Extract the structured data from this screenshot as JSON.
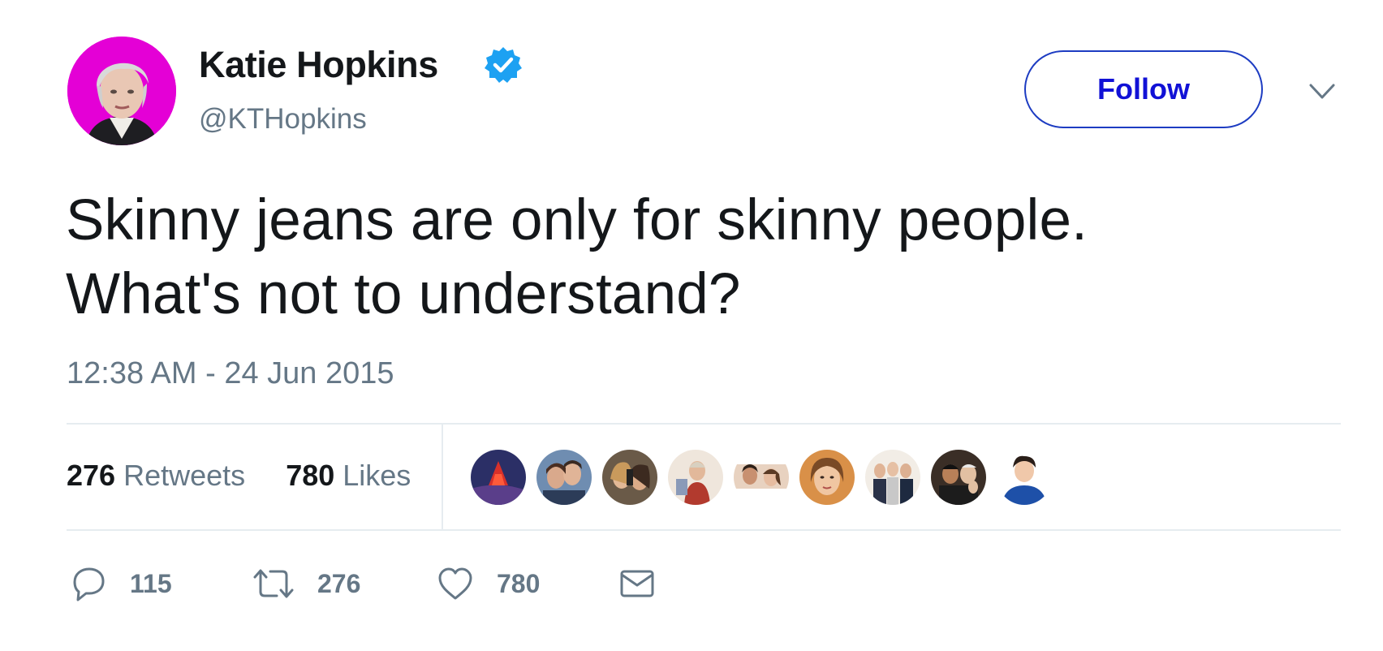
{
  "user": {
    "display_name": "Katie Hopkins",
    "handle": "@KTHopkins",
    "verified": true,
    "avatar_icon": "user-avatar"
  },
  "follow_button_label": "Follow",
  "menu_icon": "chevron-down-icon",
  "tweet": {
    "lines": [
      "Skinny jeans are only for skinny people.",
      "What's not to understand?"
    ],
    "timestamp": "12:38 AM - 24 Jun 2015"
  },
  "stats": {
    "retweets_count": "276",
    "retweets_label": "Retweets",
    "likes_count": "780",
    "likes_label": "Likes"
  },
  "likers": [
    {
      "icon": "liker-avatar-1"
    },
    {
      "icon": "liker-avatar-2"
    },
    {
      "icon": "liker-avatar-3"
    },
    {
      "icon": "liker-avatar-4"
    },
    {
      "icon": "liker-avatar-5"
    },
    {
      "icon": "liker-avatar-6"
    },
    {
      "icon": "liker-avatar-7"
    },
    {
      "icon": "liker-avatar-8"
    },
    {
      "icon": "liker-avatar-9"
    }
  ],
  "actions": {
    "reply_count": "115",
    "retweet_count": "276",
    "like_count": "780",
    "reply_icon": "reply-icon",
    "retweet_icon": "retweet-icon",
    "like_icon": "heart-icon",
    "dm_icon": "envelope-icon"
  },
  "colors": {
    "follow_text": "#1111d6",
    "follow_border": "#1d3cc2",
    "verified_badge": "#1da1f2",
    "muted_text": "#657786",
    "primary_text": "#14171a",
    "divider": "#e6ecf0"
  }
}
